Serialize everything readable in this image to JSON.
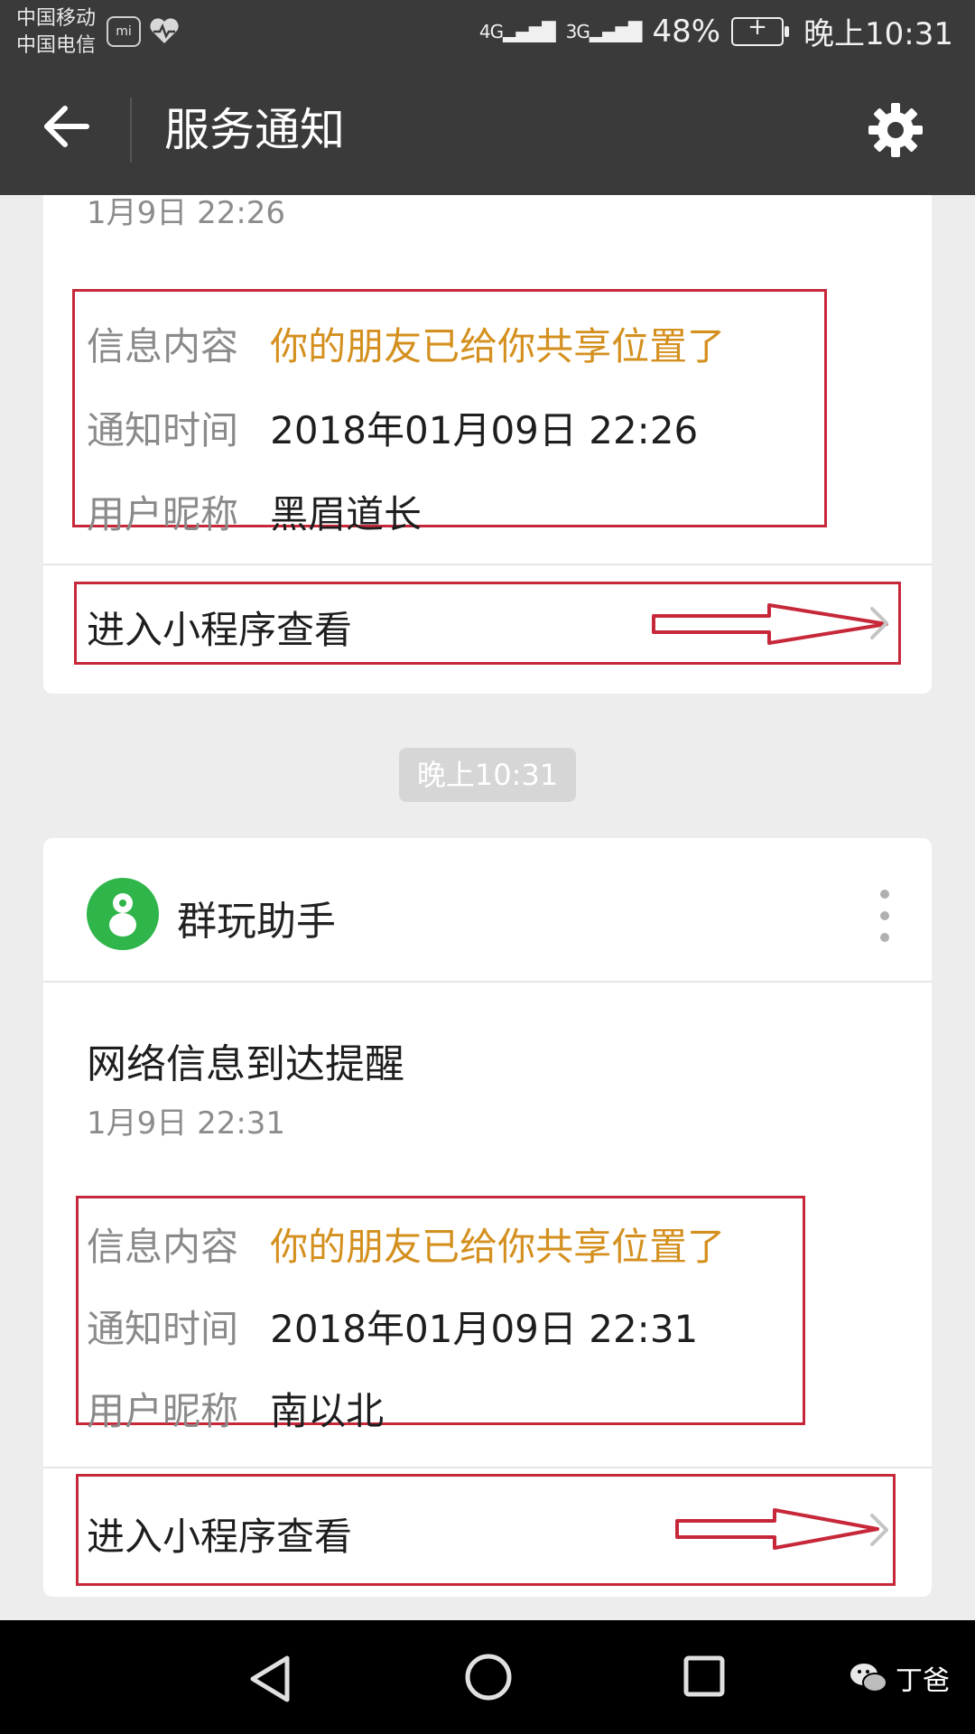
{
  "status_bar": {
    "carrier_1": "中国移动",
    "carrier_2": "中国电信",
    "mi_label": "mi",
    "network_1": "4G",
    "network_2": "3G",
    "battery_percent": "48%",
    "time": "晚上10:31"
  },
  "toolbar": {
    "title": "服务通知"
  },
  "card1": {
    "timestamp": "1月9日  22:26",
    "rows": [
      {
        "label": "信息内容",
        "value": "你的朋友已给你共享位置了"
      },
      {
        "label": "通知时间",
        "value": "2018年01月09日 22:26"
      },
      {
        "label": "用户昵称",
        "value": "黑眉道长"
      }
    ],
    "action_label": "进入小程序查看"
  },
  "time_chip": "晚上10:31",
  "card2": {
    "app_name": "群玩助手",
    "title": "网络信息到达提醒",
    "timestamp": "1月9日  22:31",
    "rows": [
      {
        "label": "信息内容",
        "value": "你的朋友已给你共享位置了"
      },
      {
        "label": "通知时间",
        "value": "2018年01月09日 22:31"
      },
      {
        "label": "用户昵称",
        "value": "南以北"
      }
    ],
    "action_label": "进入小程序查看"
  },
  "watermark": {
    "name": "丁爸"
  },
  "colors": {
    "bar_bg": "#3a3a3a",
    "page_bg": "#ededed",
    "highlight_orange": "#d4901f",
    "annotation_red": "#c6283a",
    "app_icon_green": "#2fb54a"
  }
}
